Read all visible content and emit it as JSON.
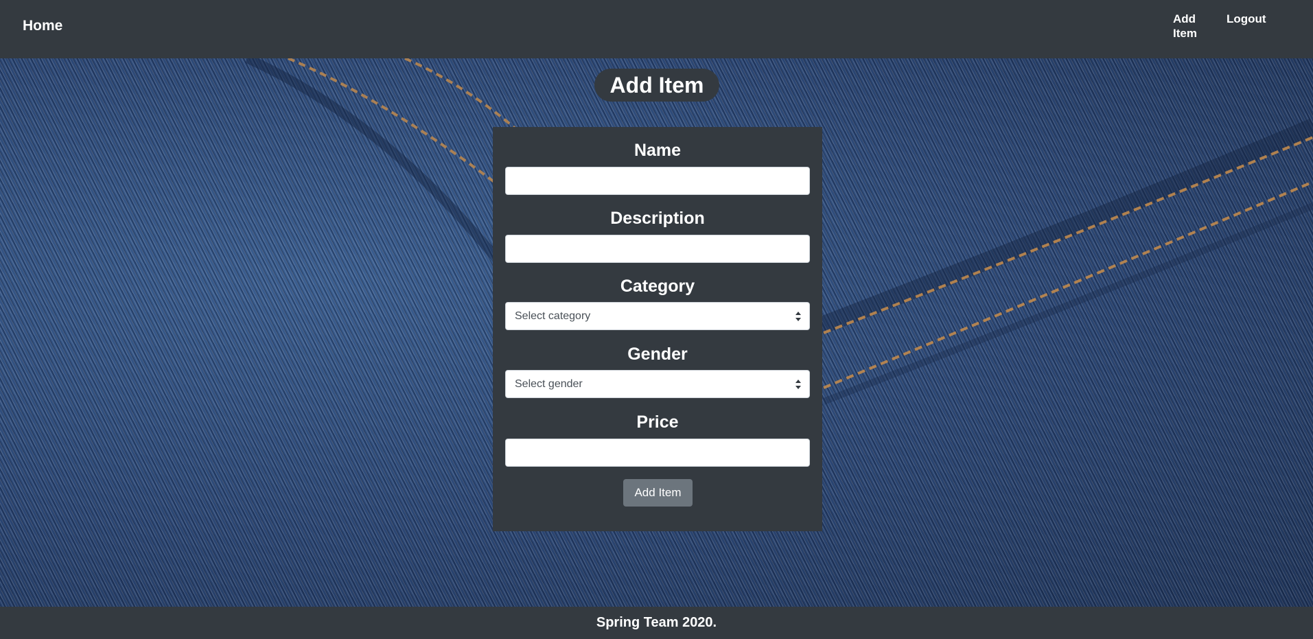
{
  "navbar": {
    "home_label": "Home",
    "add_item_label": "Add Item",
    "logout_label": "Logout"
  },
  "page": {
    "title": "Add Item"
  },
  "form": {
    "name_label": "Name",
    "name_value": "",
    "description_label": "Description",
    "description_value": "",
    "category_label": "Category",
    "category_selected": "Select category",
    "gender_label": "Gender",
    "gender_selected": "Select gender",
    "price_label": "Price",
    "price_value": "",
    "submit_label": "Add Item"
  },
  "footer": {
    "text": "Spring Team 2020."
  },
  "colors": {
    "navbar_bg": "#343a40",
    "panel_bg": "#343a40",
    "button_bg": "#6c757d",
    "denim": "#2c4a78",
    "stitching": "#c08a4e"
  },
  "icons": {
    "select_arrows": "updown-chevron-icon"
  }
}
